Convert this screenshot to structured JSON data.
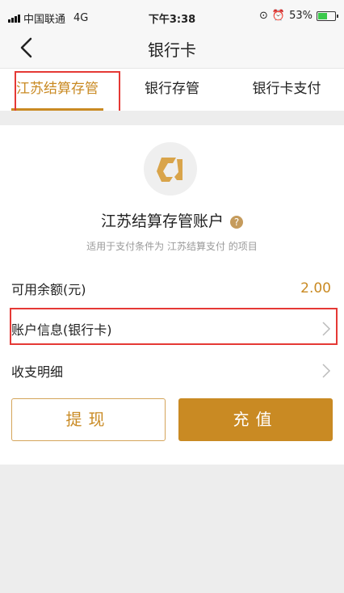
{
  "status_bar": {
    "carrier": "中国联通",
    "network": "4G",
    "time": "下午3:38",
    "battery_percent": "53%",
    "battery_level": 0.53
  },
  "nav": {
    "title": "银行卡",
    "back_icon": "chevron-left-icon"
  },
  "tabs": [
    {
      "label": "江苏结算存管",
      "active": true
    },
    {
      "label": "银行存管",
      "active": false
    },
    {
      "label": "银行卡支付",
      "active": false
    }
  ],
  "account": {
    "name": "江苏结算存管账户",
    "help_symbol": "?",
    "description": "适用于支付条件为 江苏结算支付 的项目"
  },
  "rows": {
    "balance_label": "可用余额(元)",
    "balance_value": "2.00",
    "account_info_label": "账户信息(银行卡)",
    "transactions_label": "收支明细"
  },
  "buttons": {
    "withdraw": "提现",
    "recharge": "充值"
  },
  "colors": {
    "accent": "#c98a23",
    "highlight_box": "#e53935"
  }
}
